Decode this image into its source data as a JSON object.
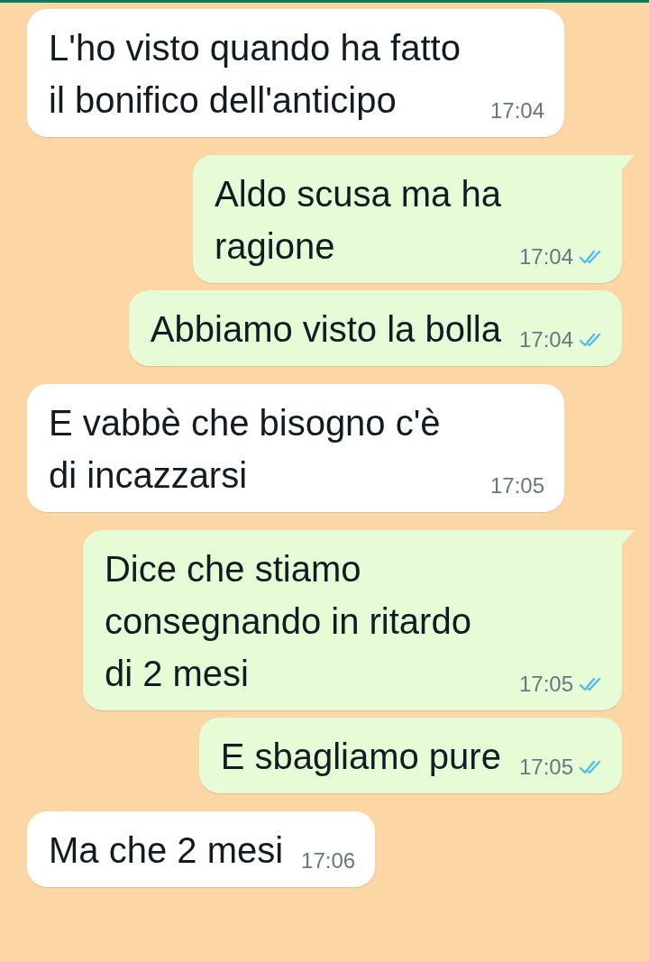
{
  "messages": [
    {
      "outgoing": false,
      "tail": false,
      "text": "L'ho visto quando ha fatto il bonifico dell'anticipo",
      "time": "17:04"
    },
    {
      "outgoing": true,
      "tail": true,
      "read": true,
      "text": "Aldo scusa ma ha\nragione",
      "time": "17:04"
    },
    {
      "outgoing": true,
      "tail": false,
      "read": true,
      "text": "Abbiamo visto la bolla",
      "time": "17:04"
    },
    {
      "outgoing": false,
      "tail": false,
      "text": "E vabbè che bisogno c'è di incazzarsi",
      "time": "17:05"
    },
    {
      "outgoing": true,
      "tail": true,
      "read": true,
      "text": "Dice che stiamo consegnando in ritardo di 2 mesi",
      "time": "17:05"
    },
    {
      "outgoing": true,
      "tail": false,
      "read": true,
      "text": "E sbagliamo pure",
      "time": "17:05"
    },
    {
      "outgoing": false,
      "tail": false,
      "text": "Ma che 2 mesi",
      "time": "17:06"
    }
  ]
}
